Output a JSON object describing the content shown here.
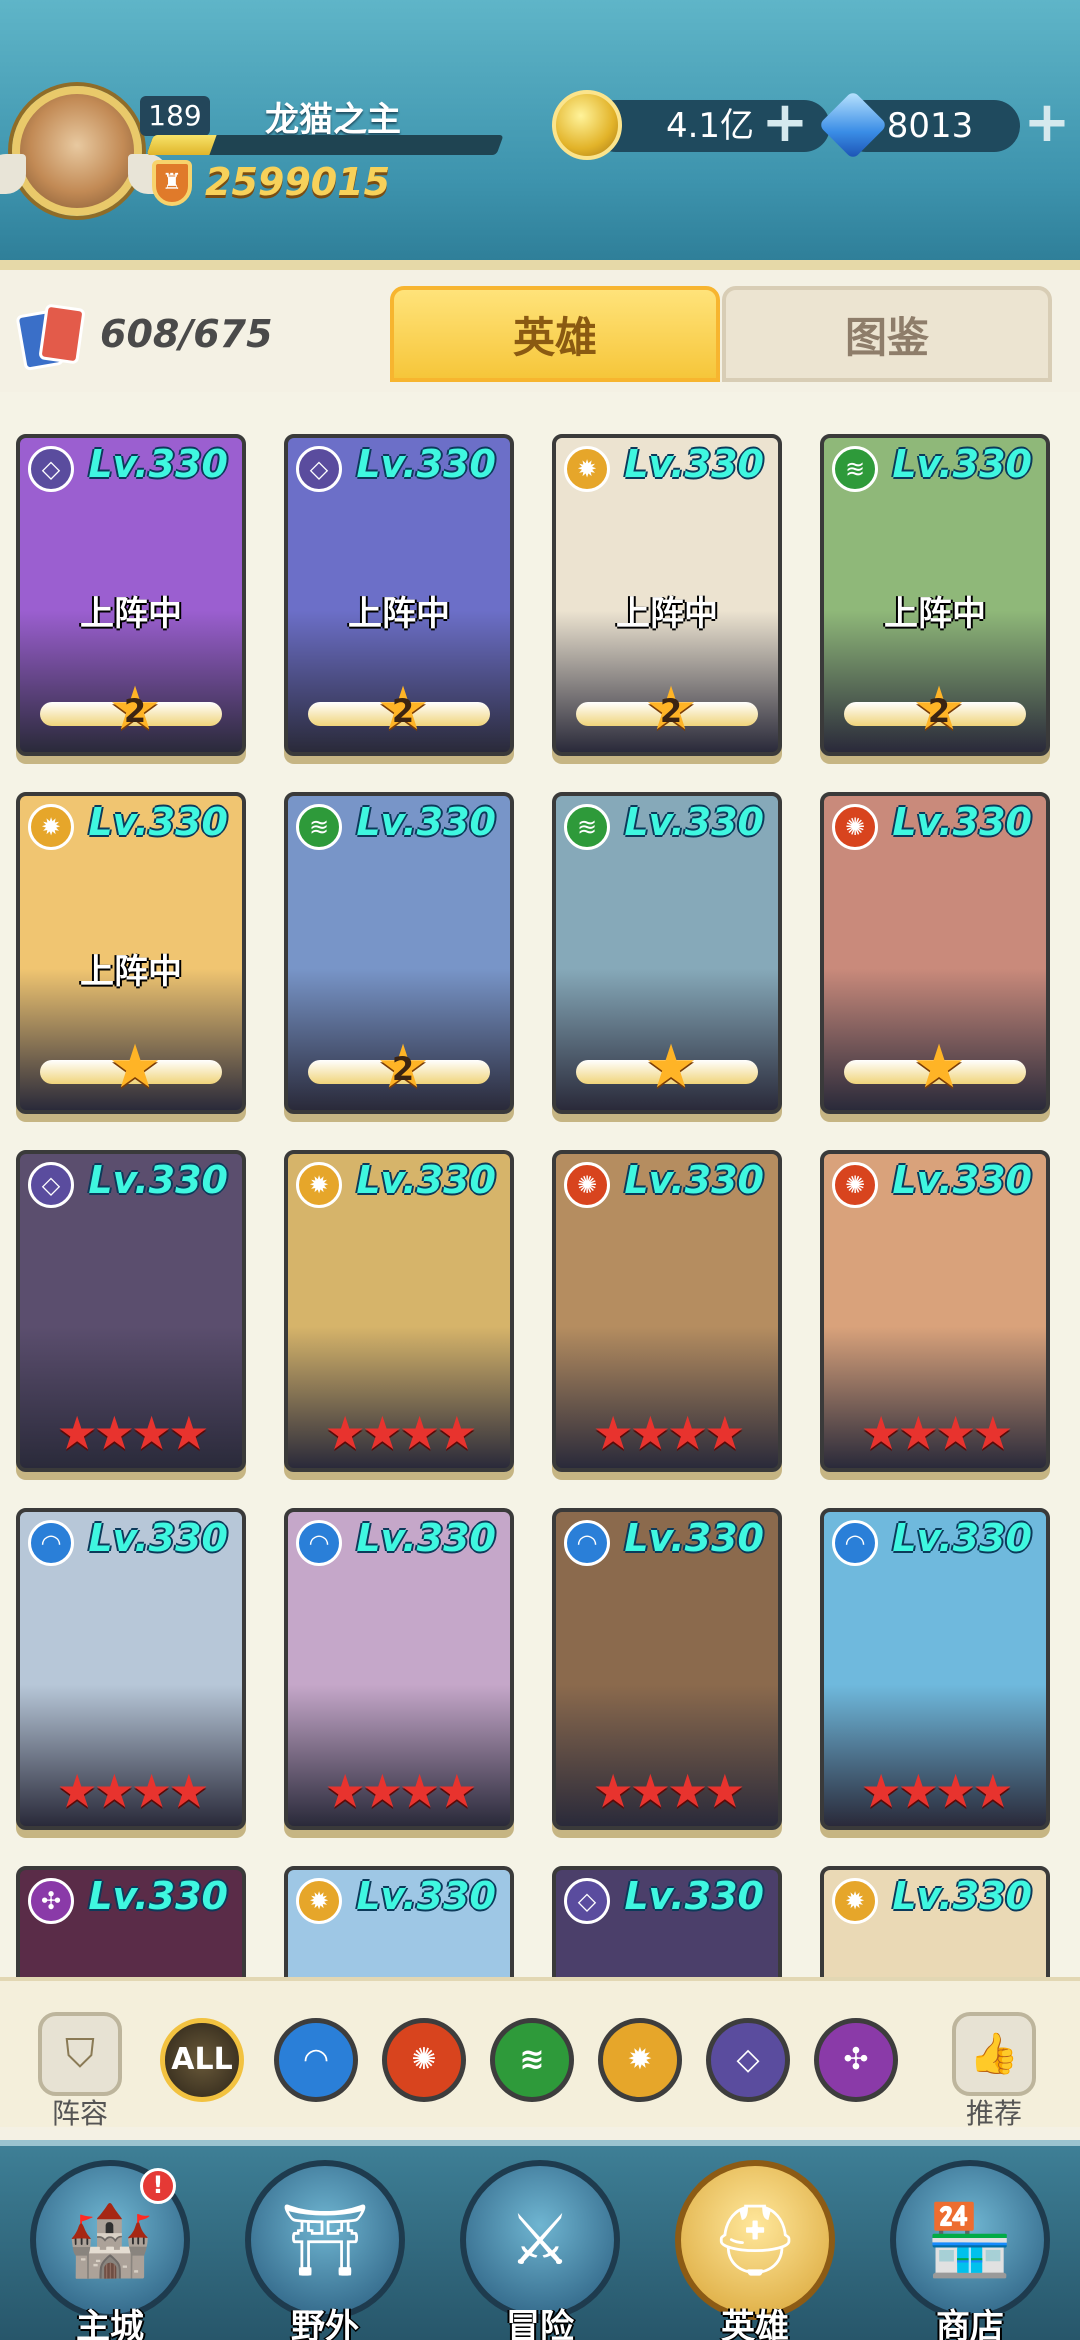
{
  "header": {
    "player_level": "189",
    "player_name": "龙猫之主",
    "power": "2599015",
    "gold": "4.1亿",
    "gems": "8013",
    "plus_symbol": "+"
  },
  "heroes_panel": {
    "hero_count": "608/675",
    "tabs": [
      "英雄",
      "图鉴"
    ]
  },
  "colors": {
    "dark": "#5a4c9e",
    "light": "#e6a62a",
    "wind": "#2e9a3a",
    "fire": "#d8441e",
    "water": "#2a7fd8",
    "void": "#8a3aa8"
  },
  "heroes": [
    {
      "level": "Lv.330",
      "element": "dark",
      "status": "上阵中",
      "badge": "2",
      "art": "#9b5fd0"
    },
    {
      "level": "Lv.330",
      "element": "dark",
      "status": "上阵中",
      "badge": "2",
      "art": "#6c6fc8"
    },
    {
      "level": "Lv.330",
      "element": "light",
      "status": "上阵中",
      "badge": "2",
      "art": "#ece3d0"
    },
    {
      "level": "Lv.330",
      "element": "wind",
      "status": "上阵中",
      "badge": "2",
      "art": "#8fb879"
    },
    {
      "level": "Lv.330",
      "element": "light",
      "status": "上阵中",
      "badge": "★",
      "art": "#f0c571"
    },
    {
      "level": "Lv.330",
      "element": "wind",
      "status": "",
      "badge": "2",
      "art": "#7895c8"
    },
    {
      "level": "Lv.330",
      "element": "wind",
      "status": "",
      "badge": "★",
      "art": "#86a9b9"
    },
    {
      "level": "Lv.330",
      "element": "fire",
      "status": "",
      "badge": "★",
      "art": "#c98a7b"
    },
    {
      "level": "Lv.330",
      "element": "dark",
      "status": "",
      "stars": "★★★★",
      "art": "#5b4e6e"
    },
    {
      "level": "Lv.330",
      "element": "light",
      "status": "",
      "stars": "★★★★",
      "art": "#d6b46a"
    },
    {
      "level": "Lv.330",
      "element": "fire",
      "status": "",
      "stars": "★★★★",
      "art": "#b58d60"
    },
    {
      "level": "Lv.330",
      "element": "fire",
      "status": "",
      "stars": "★★★★",
      "art": "#d9a27b"
    },
    {
      "level": "Lv.330",
      "element": "water",
      "status": "",
      "stars": "★★★★",
      "art": "#b7c7d8"
    },
    {
      "level": "Lv.330",
      "element": "water",
      "status": "",
      "stars": "★★★★",
      "art": "#c5a7c9"
    },
    {
      "level": "Lv.330",
      "element": "water",
      "status": "",
      "stars": "★★★★",
      "art": "#8b6a4d"
    },
    {
      "level": "Lv.330",
      "element": "water",
      "status": "",
      "stars": "★★★★",
      "art": "#6fb9dd"
    },
    {
      "level": "Lv.330",
      "element": "void",
      "status": "",
      "art": "#5a2c48"
    },
    {
      "level": "Lv.330",
      "element": "light",
      "status": "",
      "art": "#9ec7e5"
    },
    {
      "level": "Lv.330",
      "element": "dark",
      "status": "",
      "art": "#4b3f6a"
    },
    {
      "level": "Lv.330",
      "element": "light",
      "status": "",
      "art": "#ead9b5"
    }
  ],
  "filter": {
    "lineup_label": "阵容",
    "recommend_label": "推荐",
    "all_label": "ALL",
    "elements": [
      "water",
      "fire",
      "wind",
      "light",
      "dark",
      "void"
    ]
  },
  "nav": {
    "items": [
      "主城",
      "野外",
      "冒险",
      "英雄",
      "商店"
    ],
    "alert": "!"
  }
}
